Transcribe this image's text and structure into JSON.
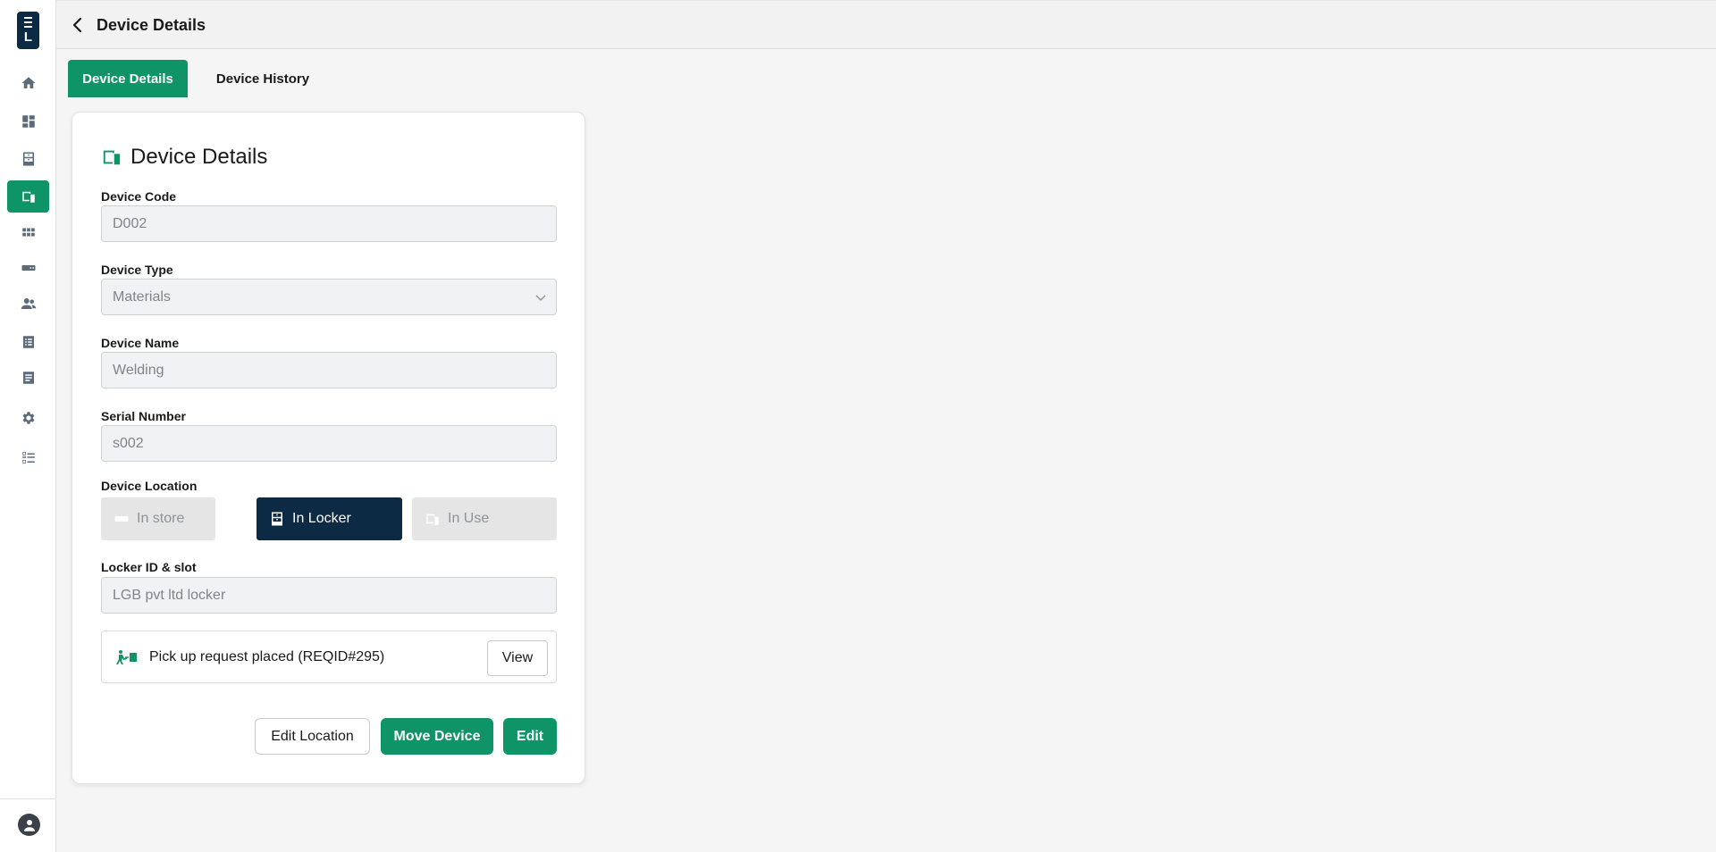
{
  "app": {
    "logo_letter": "L"
  },
  "sidebar": {
    "items": [
      {
        "name": "home",
        "icon": "home-icon"
      },
      {
        "name": "dashboard",
        "icon": "dashboard-icon"
      },
      {
        "name": "lockers",
        "icon": "locker-icon"
      },
      {
        "name": "devices",
        "icon": "devices-icon",
        "active": true
      },
      {
        "name": "apps",
        "icon": "grid-icon"
      },
      {
        "name": "tags",
        "icon": "tag-icon"
      },
      {
        "name": "users",
        "icon": "users-icon"
      },
      {
        "name": "list",
        "icon": "list-icon"
      },
      {
        "name": "reports",
        "icon": "document-icon"
      },
      {
        "name": "settings",
        "icon": "gear-icon"
      },
      {
        "name": "checklist",
        "icon": "checklist-icon"
      }
    ]
  },
  "header": {
    "title": "Device Details"
  },
  "tabs": [
    {
      "label": "Device Details",
      "active": true
    },
    {
      "label": "Device History",
      "active": false
    }
  ],
  "card": {
    "title": "Device Details",
    "fields": {
      "device_code": {
        "label": "Device Code",
        "value": "D002"
      },
      "device_type": {
        "label": "Device Type",
        "value": "Materials"
      },
      "device_name": {
        "label": "Device Name",
        "value": "Welding"
      },
      "serial_number": {
        "label": "Serial Number",
        "value": "s002"
      },
      "locker_id": {
        "label": "Locker ID & slot",
        "value": "LGB pvt ltd locker"
      }
    },
    "location": {
      "label": "Device Location",
      "options": [
        {
          "label": "In store",
          "selected": false
        },
        {
          "label": "In Locker",
          "selected": true
        },
        {
          "label": "In Use",
          "selected": false
        }
      ]
    },
    "request": {
      "text": "Pick up request placed (REQID#295)",
      "view_label": "View"
    },
    "actions": {
      "edit_location": "Edit Location",
      "move_device": "Move Device",
      "edit": "Edit"
    }
  },
  "colors": {
    "accent": "#0e9466",
    "navy": "#0c2a44"
  }
}
